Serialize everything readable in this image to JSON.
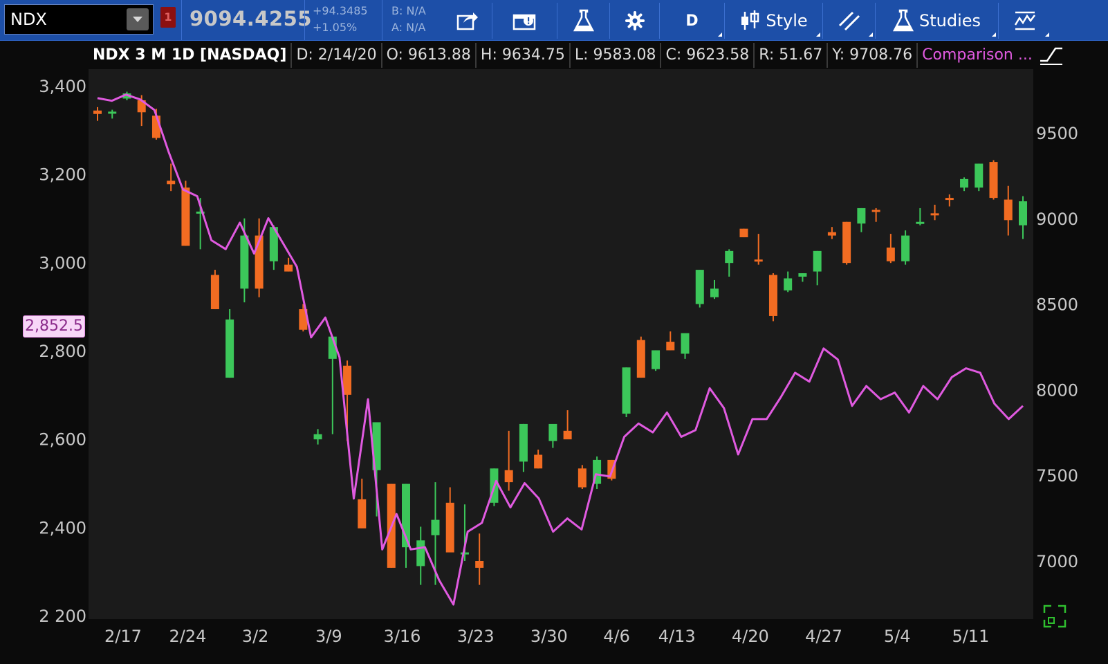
{
  "toolbar": {
    "symbol": "NDX",
    "link_badge": "1",
    "last_price": "9094.4255",
    "net_change": "+94.3485",
    "pct_change": "+1.05%",
    "bid": "B: N/A",
    "ask": "A: N/A",
    "aggregation_label": "D",
    "style_label": "Style",
    "studies_label": "Studies"
  },
  "infobar": {
    "title": "NDX 3 M 1D [NASDAQ]",
    "date": "D: 2/14/20",
    "open": "O: 9613.88",
    "high": "H: 9634.75",
    "low": "L: 9583.08",
    "close": "C: 9623.58",
    "range": "R: 51.67",
    "prev_close": "Y: 9708.76",
    "comparison": "Comparison ..."
  },
  "left_badge": "2,852.5",
  "colors": {
    "up": "#3cc75a",
    "down": "#f26c22",
    "comparison": "#e05ae0",
    "toolbar": "#1d4fa8"
  },
  "icons": [
    "share-icon",
    "alert-icon",
    "flask-icon",
    "gear-icon",
    "candlestick-icon",
    "drawing-icon",
    "studies-flask-icon",
    "pattern-icon",
    "side-panel-icon",
    "expand-icon"
  ],
  "chart_data": {
    "type": "candlestick",
    "title": "NDX 3 M 1D [NASDAQ]",
    "x_ticks": [
      "2/17",
      "2/24",
      "3/2",
      "3/9",
      "3/16",
      "3/23",
      "3/30",
      "4/6",
      "4/13",
      "4/20",
      "4/27",
      "5/4",
      "5/11"
    ],
    "y_left_ticks": [
      "3,400",
      "3,200",
      "3,000",
      "2,800",
      "2,600",
      "2,400",
      "2 200"
    ],
    "y_left_range": [
      2200,
      3400
    ],
    "y_right_ticks": [
      "9500",
      "9000",
      "8500",
      "8000",
      "7500",
      "7000"
    ],
    "y_right_range": [
      6680,
      9750
    ],
    "comparison_series": {
      "name": "Comparison",
      "values": [
        3372,
        3366,
        3380,
        3369,
        3345,
        3250,
        3165,
        3150,
        3050,
        3030,
        3090,
        3020,
        3100,
        3045,
        2990,
        2830,
        2875,
        2785,
        2465,
        2690,
        2350,
        2430,
        2350,
        2355,
        2280,
        2225,
        2390,
        2410,
        2505,
        2445,
        2500,
        2465,
        2390,
        2420,
        2395,
        2520,
        2515,
        2605,
        2635,
        2615,
        2660,
        2605,
        2620,
        2715,
        2670,
        2565,
        2645,
        2645,
        2695,
        2750,
        2730,
        2805,
        2780,
        2675,
        2720,
        2690,
        2705,
        2660,
        2720,
        2690,
        2740,
        2760,
        2750,
        2680,
        2645,
        2675
      ]
    },
    "candles": [
      {
        "date": "2/13",
        "o": 9630,
        "h": 9650,
        "l": 9570,
        "c": 9610
      },
      {
        "date": "2/14",
        "o": 9613.88,
        "h": 9634.75,
        "l": 9583.08,
        "c": 9623.58
      },
      {
        "date": "2/18",
        "o": 9700,
        "h": 9740,
        "l": 9690,
        "c": 9730
      },
      {
        "date": "2/19",
        "o": 9690,
        "h": 9720,
        "l": 9540,
        "c": 9620
      },
      {
        "date": "2/20",
        "o": 9600,
        "h": 9640,
        "l": 9460,
        "c": 9470
      },
      {
        "date": "2/21",
        "o": 9220,
        "h": 9320,
        "l": 9160,
        "c": 9200
      },
      {
        "date": "2/24",
        "o": 9180,
        "h": 9220,
        "l": 8840,
        "c": 8840
      },
      {
        "date": "2/25",
        "o": 9040,
        "h": 9120,
        "l": 8820,
        "c": 9040
      },
      {
        "date": "2/26",
        "o": 8670,
        "h": 8700,
        "l": 8470,
        "c": 8470
      },
      {
        "date": "2/27",
        "o": 8070,
        "h": 8470,
        "l": 8070,
        "c": 8410
      },
      {
        "date": "2/28",
        "o": 8590,
        "h": 9000,
        "l": 8510,
        "c": 8900
      },
      {
        "date": "3/2",
        "o": 8900,
        "h": 9000,
        "l": 8540,
        "c": 8590
      },
      {
        "date": "3/3",
        "o": 8750,
        "h": 8960,
        "l": 8700,
        "c": 8950
      },
      {
        "date": "3/4",
        "o": 8730,
        "h": 8770,
        "l": 8690,
        "c": 8690
      },
      {
        "date": "3/5",
        "o": 8470,
        "h": 8500,
        "l": 8340,
        "c": 8350
      },
      {
        "date": "3/6",
        "o": 7710,
        "h": 7770,
        "l": 7680,
        "c": 7740
      },
      {
        "date": "3/9",
        "o": 8180,
        "h": 8310,
        "l": 7740,
        "c": 8310
      },
      {
        "date": "3/10",
        "o": 8140,
        "h": 8170,
        "l": 7700,
        "c": 7970
      },
      {
        "date": "3/11",
        "o": 7360,
        "h": 7480,
        "l": 7190,
        "c": 7190
      },
      {
        "date": "3/12",
        "o": 7530,
        "h": 7810,
        "l": 7260,
        "c": 7810
      },
      {
        "date": "3/13",
        "o": 7450,
        "h": 7450,
        "l": 6960,
        "c": 6960
      },
      {
        "date": "3/16",
        "o": 7080,
        "h": 7450,
        "l": 6960,
        "c": 7450
      },
      {
        "date": "3/17",
        "o": 6970,
        "h": 7200,
        "l": 6860,
        "c": 7120
      },
      {
        "date": "3/18",
        "o": 7150,
        "h": 7460,
        "l": 6860,
        "c": 7240
      },
      {
        "date": "3/19",
        "o": 7340,
        "h": 7430,
        "l": 7080,
        "c": 7050
      },
      {
        "date": "3/20",
        "o": 7050,
        "h": 7330,
        "l": 7000,
        "c": 7050
      },
      {
        "date": "3/23",
        "o": 7000,
        "h": 7160,
        "l": 6860,
        "c": 6960
      },
      {
        "date": "3/24",
        "o": 7340,
        "h": 7540,
        "l": 7320,
        "c": 7540
      },
      {
        "date": "3/25",
        "o": 7530,
        "h": 7760,
        "l": 7410,
        "c": 7460
      },
      {
        "date": "3/26",
        "o": 7580,
        "h": 7800,
        "l": 7520,
        "c": 7800
      },
      {
        "date": "3/27",
        "o": 7620,
        "h": 7650,
        "l": 7540,
        "c": 7540
      },
      {
        "date": "3/30",
        "o": 7700,
        "h": 7790,
        "l": 7660,
        "c": 7800
      },
      {
        "date": "3/31",
        "o": 7760,
        "h": 7880,
        "l": 7740,
        "c": 7710
      },
      {
        "date": "4/1",
        "o": 7540,
        "h": 7560,
        "l": 7420,
        "c": 7430
      },
      {
        "date": "4/2",
        "o": 7450,
        "h": 7610,
        "l": 7420,
        "c": 7590
      },
      {
        "date": "4/3",
        "o": 7590,
        "h": 7590,
        "l": 7470,
        "c": 7480
      },
      {
        "date": "4/6",
        "o": 7860,
        "h": 8130,
        "l": 7840,
        "c": 8130
      },
      {
        "date": "4/7",
        "o": 8290,
        "h": 8310,
        "l": 8070,
        "c": 8070
      },
      {
        "date": "4/8",
        "o": 8120,
        "h": 8230,
        "l": 8110,
        "c": 8230
      },
      {
        "date": "4/9",
        "o": 8280,
        "h": 8340,
        "l": 8230,
        "c": 8230
      },
      {
        "date": "4/13",
        "o": 8210,
        "h": 8320,
        "l": 8180,
        "c": 8330
      },
      {
        "date": "4/14",
        "o": 8500,
        "h": 8700,
        "l": 8480,
        "c": 8700
      },
      {
        "date": "4/15",
        "o": 8540,
        "h": 8640,
        "l": 8530,
        "c": 8590
      },
      {
        "date": "4/16",
        "o": 8740,
        "h": 8820,
        "l": 8660,
        "c": 8810
      },
      {
        "date": "4/17",
        "o": 8940,
        "h": 8940,
        "l": 8890,
        "c": 8890
      },
      {
        "date": "4/20",
        "o": 8760,
        "h": 8910,
        "l": 8730,
        "c": 8750
      },
      {
        "date": "4/21",
        "o": 8670,
        "h": 8680,
        "l": 8400,
        "c": 8430
      },
      {
        "date": "4/22",
        "o": 8580,
        "h": 8690,
        "l": 8570,
        "c": 8650
      },
      {
        "date": "4/23",
        "o": 8660,
        "h": 8680,
        "l": 8630,
        "c": 8680
      },
      {
        "date": "4/24",
        "o": 8690,
        "h": 8810,
        "l": 8610,
        "c": 8810
      },
      {
        "date": "4/27",
        "o": 8920,
        "h": 8950,
        "l": 8880,
        "c": 8900
      },
      {
        "date": "4/28",
        "o": 8980,
        "h": 8980,
        "l": 8730,
        "c": 8740
      },
      {
        "date": "4/29",
        "o": 8970,
        "h": 9060,
        "l": 8920,
        "c": 9060
      },
      {
        "date": "4/30",
        "o": 9050,
        "h": 9060,
        "l": 8980,
        "c": 9040
      },
      {
        "date": "5/1",
        "o": 8830,
        "h": 8910,
        "l": 8740,
        "c": 8750
      },
      {
        "date": "5/4",
        "o": 8750,
        "h": 8930,
        "l": 8730,
        "c": 8900
      },
      {
        "date": "5/5",
        "o": 8970,
        "h": 9060,
        "l": 8960,
        "c": 8980
      },
      {
        "date": "5/6",
        "o": 9030,
        "h": 9080,
        "l": 8990,
        "c": 9020
      },
      {
        "date": "5/7",
        "o": 9120,
        "h": 9140,
        "l": 9070,
        "c": 9110
      },
      {
        "date": "5/8",
        "o": 9180,
        "h": 9240,
        "l": 9160,
        "c": 9230
      },
      {
        "date": "5/11",
        "o": 9180,
        "h": 9320,
        "l": 9160,
        "c": 9320
      },
      {
        "date": "5/12",
        "o": 9330,
        "h": 9340,
        "l": 9110,
        "c": 9120
      },
      {
        "date": "5/13",
        "o": 9110,
        "h": 9190,
        "l": 8900,
        "c": 8990
      },
      {
        "date": "5/14",
        "o": 8960,
        "h": 9130,
        "l": 8880,
        "c": 9100
      }
    ]
  }
}
